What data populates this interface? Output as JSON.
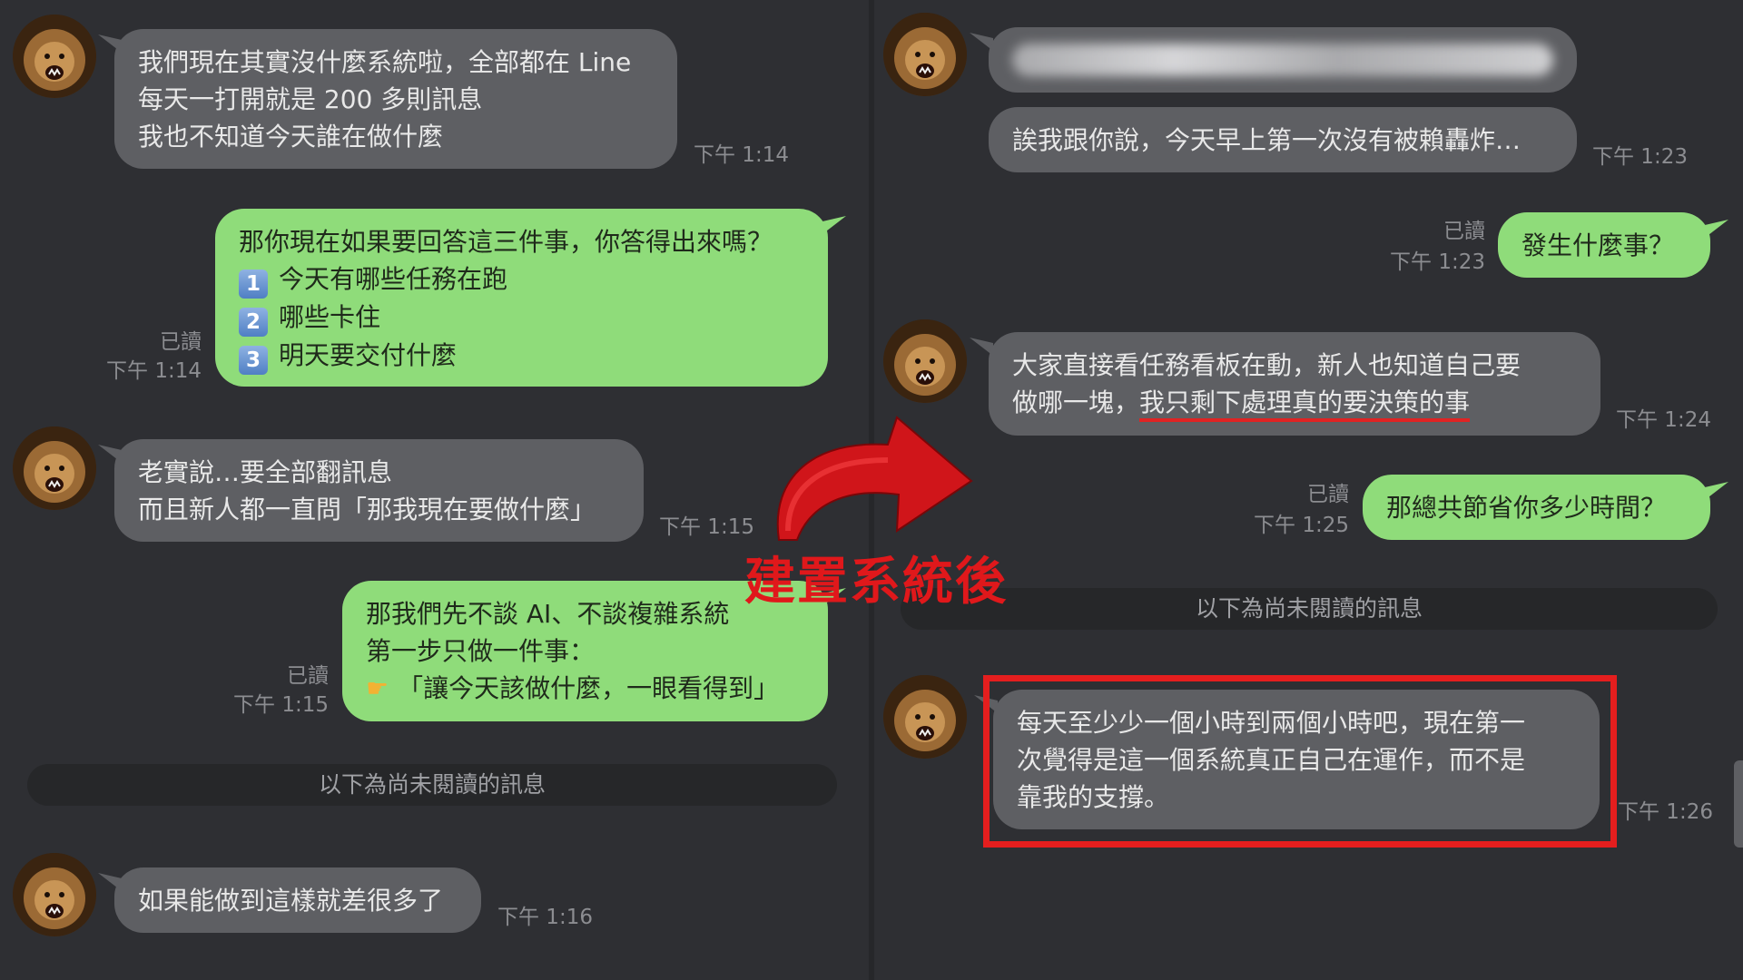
{
  "left": {
    "messages": [
      {
        "lines": [
          "我們現在其實沒什麼系統啦，全部都在 Line",
          "每天一打開就是 200 多則訊息",
          "我也不知道今天誰在做什麼"
        ],
        "time": "下午 1:14"
      },
      {
        "lines": [
          "那你現在如果要回答這三件事，你答得出來嗎？"
        ],
        "items": [
          {
            "num": "1",
            "text": "今天有哪些任務在跑"
          },
          {
            "num": "2",
            "text": "哪些卡住"
          },
          {
            "num": "3",
            "text": "明天要交付什麼"
          }
        ],
        "read": "已讀",
        "time": "下午 1:14"
      },
      {
        "lines": [
          "老實說…要全部翻訊息",
          "而且新人都一直問「那我現在要做什麼」"
        ],
        "time": "下午 1:15"
      },
      {
        "lines": [
          "那我們先不談 AI、不談複雜系統",
          "第一步只做一件事："
        ],
        "pointer_line": "「讓今天該做什麼，一眼看得到」",
        "read": "已讀",
        "time": "下午 1:15"
      },
      {
        "lines": [
          "如果能做到這樣就差很多了"
        ],
        "time": "下午 1:16"
      }
    ],
    "unread_divider": "以下為尚未閱讀的訊息"
  },
  "right": {
    "messages": [
      {
        "lines": [
          "誒我跟你說，今天早上第一次沒有被賴轟炸…"
        ],
        "time": "下午 1:23"
      },
      {
        "lines": [
          "發生什麼事？"
        ],
        "read": "已讀",
        "time": "下午 1:23"
      },
      {
        "lines": [
          "大家直接看任務看板在動，新人也知道自己要"
        ],
        "line2_prefix": "做哪一塊，",
        "line2_underlined": "我只剩下處理真的要決策的事",
        "time": "下午 1:24"
      },
      {
        "lines": [
          "那總共節省你多少時間？"
        ],
        "read": "已讀",
        "time": "下午 1:25"
      },
      {
        "lines": [
          "每天至少少一個小時到兩個小時吧，現在第一",
          "次覺得是這一個系統真正自己在運作，而不是",
          "靠我的支撐。"
        ],
        "time": "下午 1:26"
      }
    ],
    "unread_divider": "以下為尚未閱讀的訊息"
  },
  "overlay": {
    "label": "建置系統後",
    "color": "#e0181b"
  },
  "icons": {
    "avatar": "lion-avatar-icon",
    "pointer": "pointing-hand-icon",
    "arrow": "curved-arrow-icon"
  },
  "colors": {
    "incoming_bubble": "#5e5f63",
    "outgoing_bubble": "#8fdc7a",
    "background": "#2e2f33",
    "highlight": "#e41e1e"
  }
}
